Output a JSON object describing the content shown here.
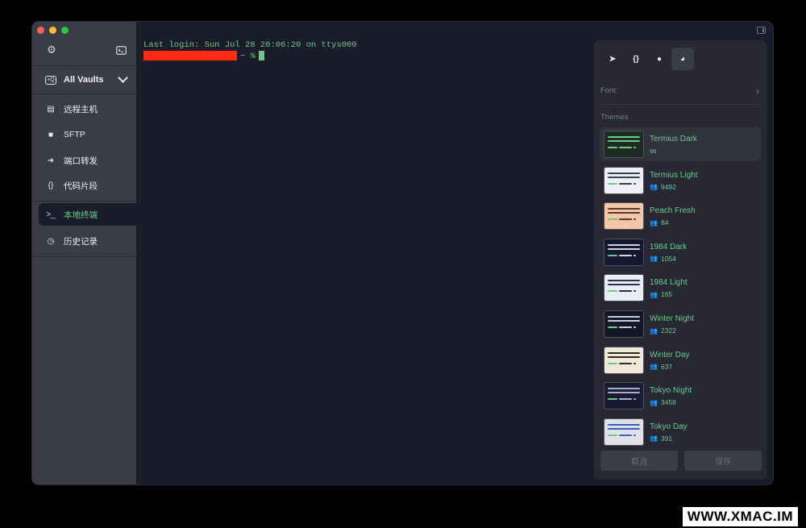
{
  "window": {
    "traffic": [
      "close",
      "minimize",
      "zoom"
    ]
  },
  "sidebar": {
    "settings_icon": "gear-icon",
    "terminal_icon": "terminal-icon",
    "vault": {
      "icon_text": "+Q",
      "label": "All Vaults"
    },
    "items": [
      {
        "label": "远程主机",
        "icon": "▤"
      },
      {
        "label": "SFTP",
        "icon": "■"
      },
      {
        "label": "端口转发",
        "icon": "➜"
      },
      {
        "label": "代码片段",
        "icon": "{}"
      },
      {
        "label": "本地终端",
        "icon": ">_"
      },
      {
        "label": "历史记录",
        "icon": "◷"
      }
    ]
  },
  "terminal": {
    "line1": "Last login: Sun Jul 28 20:06:20 on ttys000",
    "prompt": "~ %"
  },
  "panel": {
    "tabs": [
      {
        "name": "rocket-icon",
        "glyph": "➤"
      },
      {
        "name": "braces-icon",
        "glyph": "{}"
      },
      {
        "name": "circle-icon",
        "glyph": "●"
      },
      {
        "name": "palette-icon",
        "glyph": "◕"
      }
    ],
    "font_label": "Font",
    "font_arrow": "›",
    "themes_title": "Themes",
    "themes": [
      {
        "name": "Termius Dark",
        "count": "∞",
        "bg": "#1e2b22",
        "fg": "#6dc88a"
      },
      {
        "name": "Termius Light",
        "count": "9492",
        "bg": "#eef0f5",
        "fg": "#3c4150"
      },
      {
        "name": "Peach Fresh",
        "count": "84",
        "bg": "#f4c7a8",
        "fg": "#5a3a2a"
      },
      {
        "name": "1984 Dark",
        "count": "1054",
        "bg": "#14172e",
        "fg": "#d0d2e0"
      },
      {
        "name": "1984 Light",
        "count": "165",
        "bg": "#e9edf7",
        "fg": "#2a2f4a"
      },
      {
        "name": "Winter Night",
        "count": "2322",
        "bg": "#151824",
        "fg": "#c9ccd8"
      },
      {
        "name": "Winter Day",
        "count": "637",
        "bg": "#f0e8d8",
        "fg": "#2e2b26"
      },
      {
        "name": "Tokyo Night",
        "count": "3458",
        "bg": "#1a1b2e",
        "fg": "#a9b1d6"
      },
      {
        "name": "Tokyo Day",
        "count": "391",
        "bg": "#e1e2e7",
        "fg": "#3760bf"
      }
    ],
    "cancel_label": "取消",
    "save_label": "保存"
  },
  "colors": {
    "accent": "#6dc88a",
    "redaction": "#ff2a12"
  },
  "watermark": "WWW.XMAC.IM"
}
